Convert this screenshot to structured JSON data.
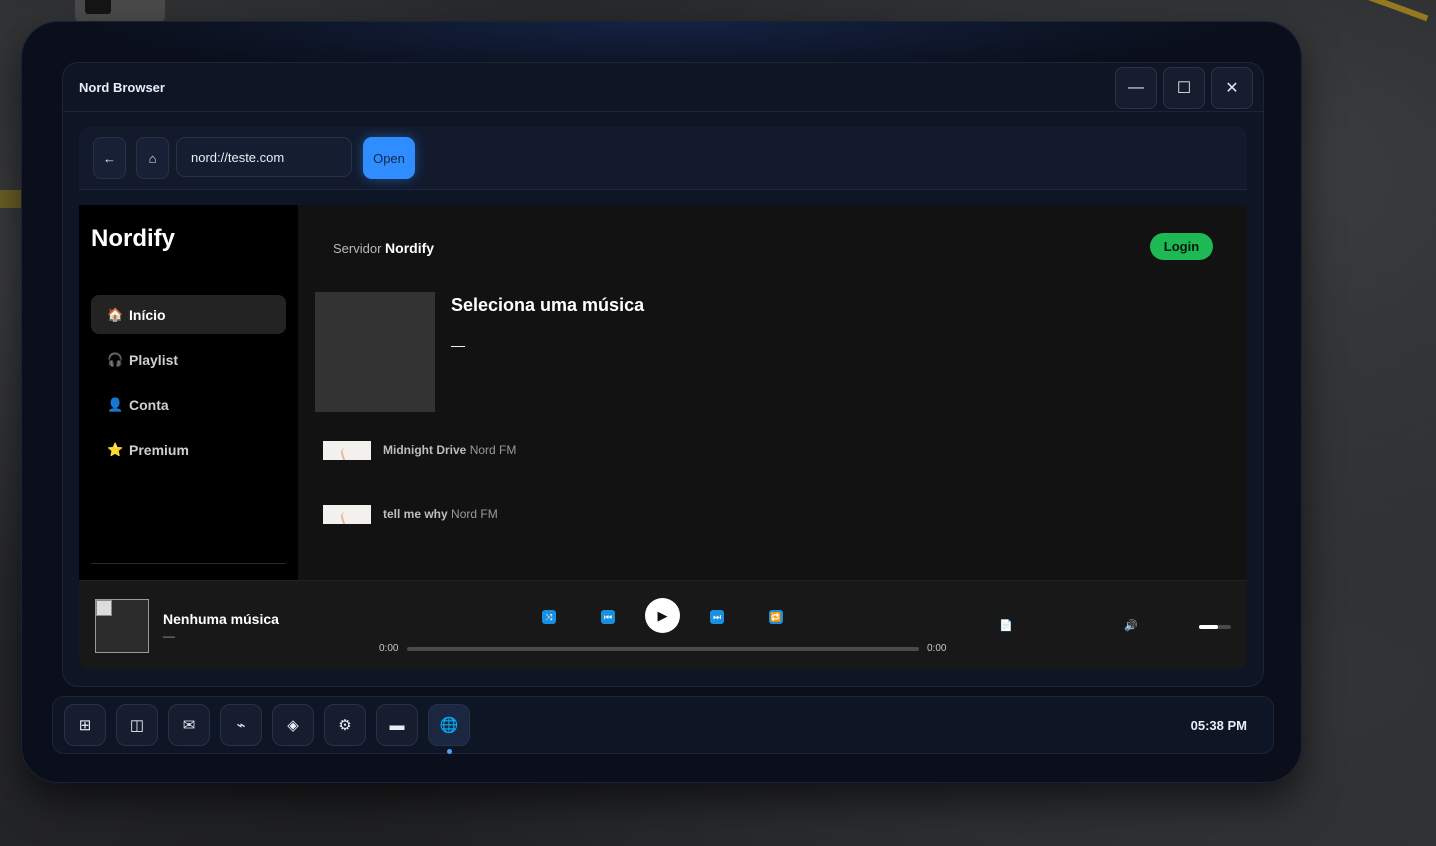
{
  "browser": {
    "title": "Nord Browser",
    "minimize_icon": "—",
    "maximize_icon": "☐",
    "close_icon": "✕",
    "back_icon": "←",
    "home_icon": "⌂",
    "url_value": "nord://teste.com",
    "open_label": "Open"
  },
  "app": {
    "brand": "Nordify",
    "nav": [
      {
        "icon": "🏠",
        "label": "Início",
        "active": true
      },
      {
        "icon": "🎧",
        "label": "Playlist",
        "active": false
      },
      {
        "icon": "👤",
        "label": "Conta",
        "active": false
      },
      {
        "icon": "⭐",
        "label": "Premium",
        "active": false
      }
    ],
    "server_prefix": "Servidor",
    "server_name": "Nordify",
    "login_label": "Login",
    "now_title": "Seleciona uma música",
    "now_sub": "—",
    "tracks": [
      {
        "name": "Midnight Drive",
        "artist": "Nord FM"
      },
      {
        "name": "tell me why",
        "artist": "Nord FM"
      }
    ]
  },
  "player": {
    "title": "Nenhuma música",
    "sub": "—",
    "time_current": "0:00",
    "time_total": "0:00",
    "progress": 0,
    "volume": 0.6,
    "shuffle_icon": "⤨",
    "prev_icon": "⏮",
    "play_icon": "▶",
    "next_icon": "⏭",
    "repeat_icon": "🔁",
    "lyrics_icon": "📄",
    "volume_icon": "🔊"
  },
  "dock": {
    "apps": [
      "⊞",
      "◫",
      "✉",
      "⌁",
      "◈",
      "⚙",
      "▬",
      "🌐"
    ],
    "clock": "05:38 PM"
  },
  "colors": {
    "accent_blue": "#2f8dff",
    "spotify_green": "#1db954",
    "control_blue": "#1a8fe0"
  }
}
